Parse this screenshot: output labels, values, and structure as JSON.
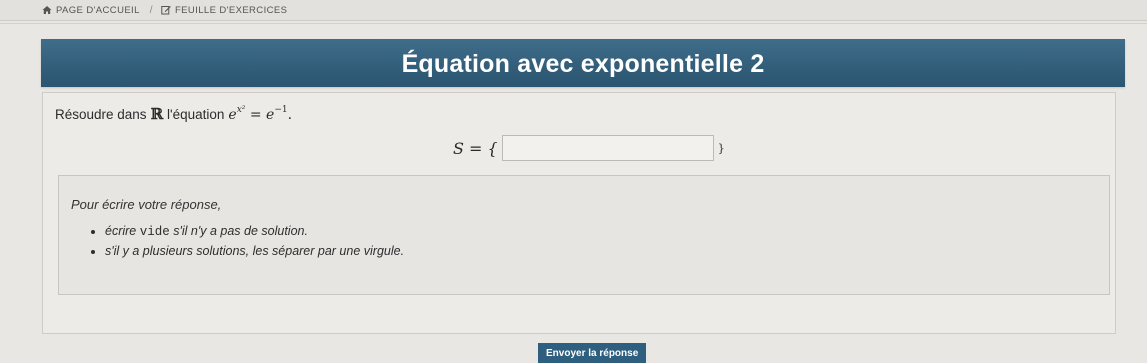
{
  "breadcrumb": {
    "home_label": "PAGE D'ACCUEIL",
    "separator": "/",
    "current_label": "FEUILLE D'EXERCICES"
  },
  "exercise": {
    "title": "Équation avec exponentielle 2",
    "statement_prefix": "Résoudre dans",
    "set_symbol": "ℝ",
    "statement_middle": "l'équation",
    "equation": {
      "base_left": "e",
      "exp_left": "x²",
      "equals": " = ",
      "base_right": "e",
      "exp_right": "−1",
      "end": "."
    }
  },
  "answer": {
    "prefix": "S = {",
    "suffix": "}",
    "value": ""
  },
  "hint": {
    "title": "Pour écrire votre réponse,",
    "item1_before": "écrire",
    "item1_code": "vide",
    "item1_after": "s'il n'y a pas de solution.",
    "item2": "s'il y a plusieurs solutions, les séparer par une virgule."
  },
  "submit_label": "Envoyer la réponse",
  "icons": {
    "home": "home-icon",
    "edit": "edit-icon"
  },
  "colors": {
    "banner": "#335f7b",
    "button": "#2f5f7f"
  }
}
